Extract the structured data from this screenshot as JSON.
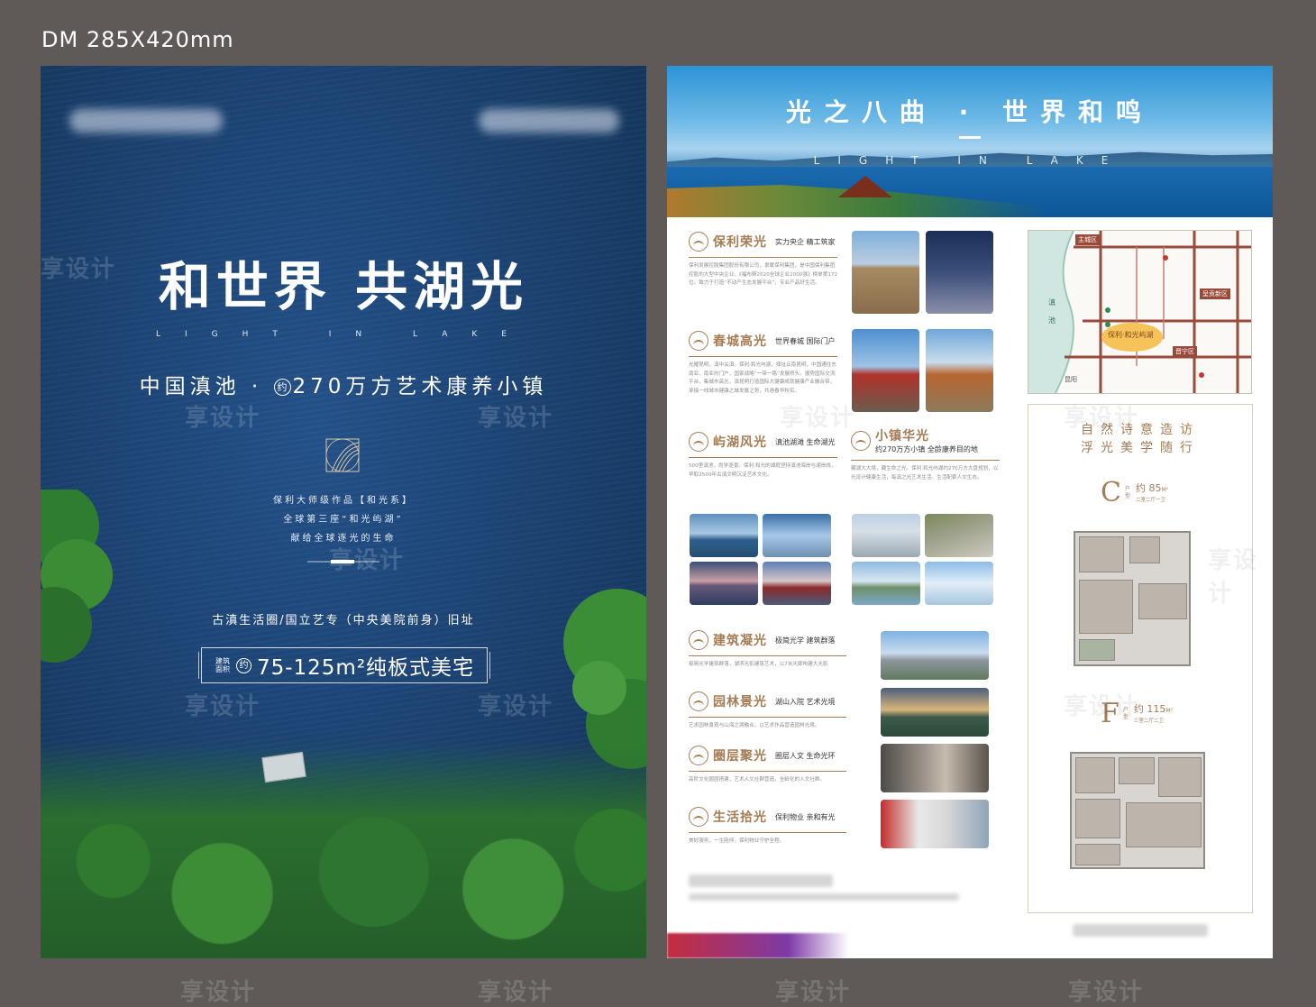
{
  "dm_label": "DM 285X420mm",
  "left_poster": {
    "headline": "和世界 共湖光",
    "subtitle_en": "LIGHT IN LAKE",
    "subtitle_cn_prefix": "中国滇池 ·",
    "subtitle_cn_circle": "约",
    "subtitle_cn_suffix": "270万方艺术康养小镇",
    "intro_lines": [
      "保利大师级作品【和光系】",
      "全球第三座“和光屿湖”",
      "献给全球逐光的生命"
    ],
    "heritage": "古滇生活圈/国立艺专（中央美院前身）旧址",
    "area_prefix": "建筑面积",
    "area_circle": "约",
    "area_text": "75-125m²纯板式美宅"
  },
  "right_poster": {
    "banner_title": "光之八曲 · 世界和鸣",
    "banner_en": "LIGHT IN LAKE",
    "sections": [
      {
        "title": "保利荣光",
        "tag": "实力央企 精工筑家",
        "text": "保利发展控股集团股份有限公司，隶属保利集团，是中国保利集团控股的大型中央企业。《福布斯2020全球企业2000强》榜单第172位。致力于打造“不动产生态发展平台”，专业产品好生活。"
      },
      {
        "title": "春城高光",
        "tag": "世界春城 国际门户",
        "text": "光耀昆明，滇中古滇。保利·和光屿湖，择址云南昆明，中国通往东南亚、南亚的门户，国家战略“一带一路”发展桥头。顺势国际交流平台，集城市高光，滇昆明打造国际大健康成就健康产业融合带，承接一线城市健康之城发展之势，共遇春华秋实。"
      },
      {
        "title": "屿湖风光",
        "tag": "滇池湖滩 生命湖光",
        "text": "500里滇池，尚学逐景。保利·和光的湖庭坚持滇池海岸与湖岸线，早取2500年古滇文明沉淀艺术文化。"
      },
      {
        "title": "小镇华光",
        "tag_line1": "约270万方小镇",
        "tag_line2": "全龄康养目的地",
        "text": "藏湖大大境，藏生命之光。保利·和光屿湖约270万方大盘规划，以光设计健康生活，每滇之光艺术生活。生活配套人文生态。"
      },
      {
        "title": "建筑凝光",
        "tag": "极简光学 建筑群落",
        "text": "极简光学建筑群落，湖滨光影建筑艺术，以7米光廊构建大光影"
      },
      {
        "title": "园林景光",
        "tag": "湖山入院 艺术光境",
        "text": "艺术园林景观与山海之境融合，以艺术作品营造园林光境。"
      },
      {
        "title": "圈层聚光",
        "tag": "圈层人文 生命光环",
        "text": "高阶文化圈层搭建，艺术人文社群营造，全龄化的人文社群。"
      },
      {
        "title": "生活拾光",
        "tag": "保利物业 亲和有光",
        "text": "美好服务，一生陪伴。保利物业守护全程。"
      }
    ],
    "map": {
      "labels": [
        "主城区",
        "滇池",
        "呈贡新区",
        "晋宁区",
        "昆阳",
        "保利·和光屿湖"
      ]
    },
    "floorplans": {
      "slogan_line1": "自然诗意造访",
      "slogan_line2": "浮光美学随行",
      "units": [
        {
          "letter": "C",
          "type_label": "户型",
          "area_prefix": "约",
          "area": "85",
          "unit": "M²",
          "rooms": "二室二厅一卫"
        },
        {
          "letter": "F",
          "type_label": "户型",
          "area_prefix": "约",
          "area": "115",
          "unit": "M²",
          "rooms": "三室二厅二卫"
        }
      ]
    }
  },
  "watermark": "享设计"
}
